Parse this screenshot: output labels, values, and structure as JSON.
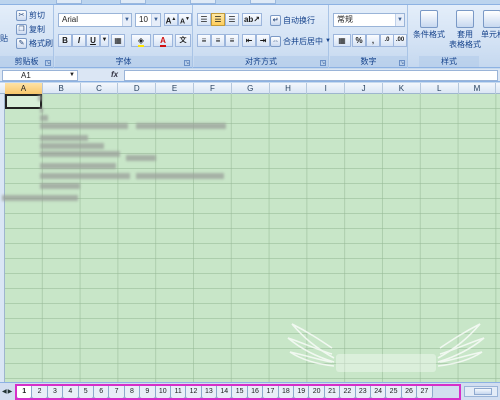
{
  "ribbon": {
    "clipboard": {
      "paste_label": "贴",
      "cut_label": "剪切",
      "copy_label": "复制",
      "format_painter_label": "格式刷",
      "group_label": "剪贴板"
    },
    "font": {
      "font_name": "Arial",
      "font_size": "10",
      "bold": "B",
      "italic": "I",
      "underline": "U",
      "font_color": "A",
      "group_label": "字体"
    },
    "alignment": {
      "wrap_text_label": "自动换行",
      "merge_center_label": "合并后居中",
      "group_label": "对齐方式"
    },
    "number": {
      "format": "常规",
      "percent": "%",
      "comma": ",",
      "group_label": "数字"
    },
    "styles": {
      "conditional_format_label_1": "条件格式",
      "table_format_label_1": "套用",
      "table_format_label_2": "表格格式",
      "cell_styles_label_1": "单元格",
      "group_label": "样式"
    }
  },
  "formula_bar": {
    "name_box": "A1",
    "fx_label": "fx"
  },
  "grid": {
    "columns": [
      "A",
      "B",
      "C",
      "D",
      "E",
      "F",
      "G",
      "H",
      "I",
      "J",
      "K",
      "L",
      "M"
    ],
    "selected_column": "A"
  },
  "sheet_tabs": {
    "tabs": [
      "1",
      "2",
      "3",
      "4",
      "5",
      "6",
      "7",
      "8",
      "9",
      "10",
      "11",
      "12",
      "13",
      "14",
      "15",
      "16",
      "17",
      "18",
      "19",
      "20",
      "21",
      "22",
      "23",
      "24",
      "25",
      "26",
      "27"
    ],
    "active_tab": "1"
  },
  "colors": {
    "grid_background": "#c8e6c8",
    "highlight_border": "#d62fc8",
    "ribbon_text": "#15428b"
  }
}
